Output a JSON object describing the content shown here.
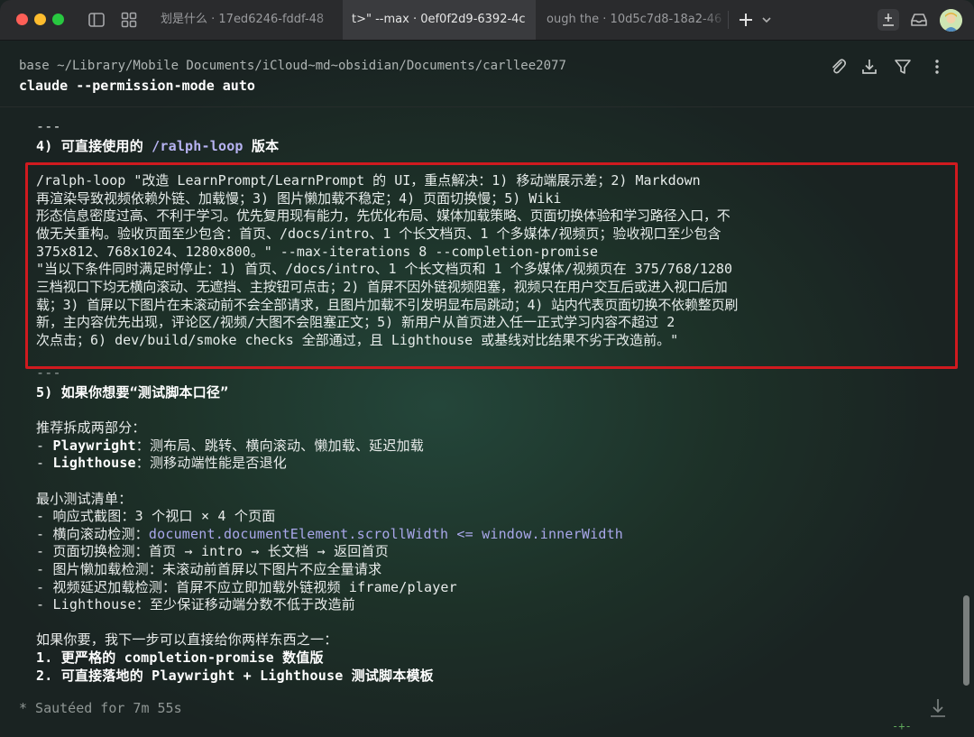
{
  "tabs": [
    {
      "label": "划是什么 · 17ed6246-fddf-48"
    },
    {
      "label": "t>\" --max · 0ef0f2d9-6392-4c"
    },
    {
      "label": "ough the · 10d5c7d8-18a2-46"
    }
  ],
  "header": {
    "path": "base ~/Library/Mobile Documents/iCloud~md~obsidian/Documents/carllee2077",
    "command": "claude --permission-mode auto"
  },
  "section4": {
    "rule": "---",
    "heading_prefix": "4) 可直接使用的 ",
    "heading_cmd": "/ralph-loop",
    "heading_suffix": " 版本"
  },
  "highlighted": {
    "lines": [
      "/ralph-loop \"改造 LearnPrompt/LearnPrompt 的 UI，重点解决：1) 移动端展示差；2) Markdown",
      "再渲染导致视频依赖外链、加载慢；3) 图片懒加载不稳定；4) 页面切换慢；5) Wiki",
      "形态信息密度过高、不利于学习。优先复用现有能力，先优化布局、媒体加载策略、页面切换体验和学习路径入口，不",
      "做无关重构。验收页面至少包含：首页、/docs/intro、1 个长文档页、1 个多媒体/视频页；验收视口至少包含",
      "375x812、768x1024、1280x800。\" --max-iterations 8 --completion-promise",
      "\"当以下条件同时满足时停止：1) 首页、/docs/intro、1 个长文档页和 1 个多媒体/视频页在 375/768/1280",
      "三档视口下均无横向滚动、无遮挡、主按钮可点击；2) 首屏不因外链视频阻塞，视频只在用户交互后或进入视口后加",
      "载；3) 首屏以下图片在未滚动前不会全部请求，且图片加载不引发明显布局跳动；4) 站内代表页面切换不依赖整页刷",
      "新，主内容优先出现，评论区/视频/大图不会阻塞正文；5) 新用户从首页进入任一正式学习内容不超过 2",
      "次点击；6) dev/build/smoke checks 全部通过，且 Lighthouse 或基线对比结果不劣于改造前。\""
    ]
  },
  "section5": {
    "rule": "---",
    "heading": "5) 如果你想要“测试脚本口径”",
    "intro": "推荐拆成两部分：",
    "parts": [
      {
        "prefix": "- ",
        "name": "Playwright",
        "desc": "：测布局、跳转、横向滚动、懒加载、延迟加载"
      },
      {
        "prefix": "- ",
        "name": "Lighthouse",
        "desc": "：测移动端性能是否退化"
      }
    ],
    "checklist_title": "最小测试清单：",
    "checklist": [
      {
        "text": "- 响应式截图：3 个视口 × 4 个页面",
        "code": ""
      },
      {
        "text": "- 横向滚动检测：",
        "code": "document.documentElement.scrollWidth <= window.innerWidth"
      },
      {
        "text": "- 页面切换检测：首页 → intro → 长文档 → 返回首页",
        "code": ""
      },
      {
        "text": "- 图片懒加载检测：未滚动前首屏以下图片不应全量请求",
        "code": ""
      },
      {
        "text": "- 视频延迟加载检测：首屏不应立即加载外链视频 iframe/player",
        "code": ""
      },
      {
        "text": "- Lighthouse：至少保证移动端分数不低于改造前",
        "code": ""
      }
    ],
    "offer": "如果你要，我下一步可以直接给你两样东西之一：",
    "options": [
      "1. 更严格的 completion-promise 数值版",
      "2. 可直接落地的 Playwright + Lighthouse 测试脚本模板"
    ]
  },
  "status": "* Sautéed for 7m 55s",
  "corner_mark": "-+-",
  "icons": [
    "sidebar-toggle-icon",
    "grid-icon",
    "new-tab-plus-icon",
    "chevron-down-icon",
    "download-tray-icon",
    "inbox-icon",
    "paperclip-icon",
    "download-icon",
    "filter-icon",
    "more-vertical-icon",
    "jump-to-bottom-icon"
  ]
}
